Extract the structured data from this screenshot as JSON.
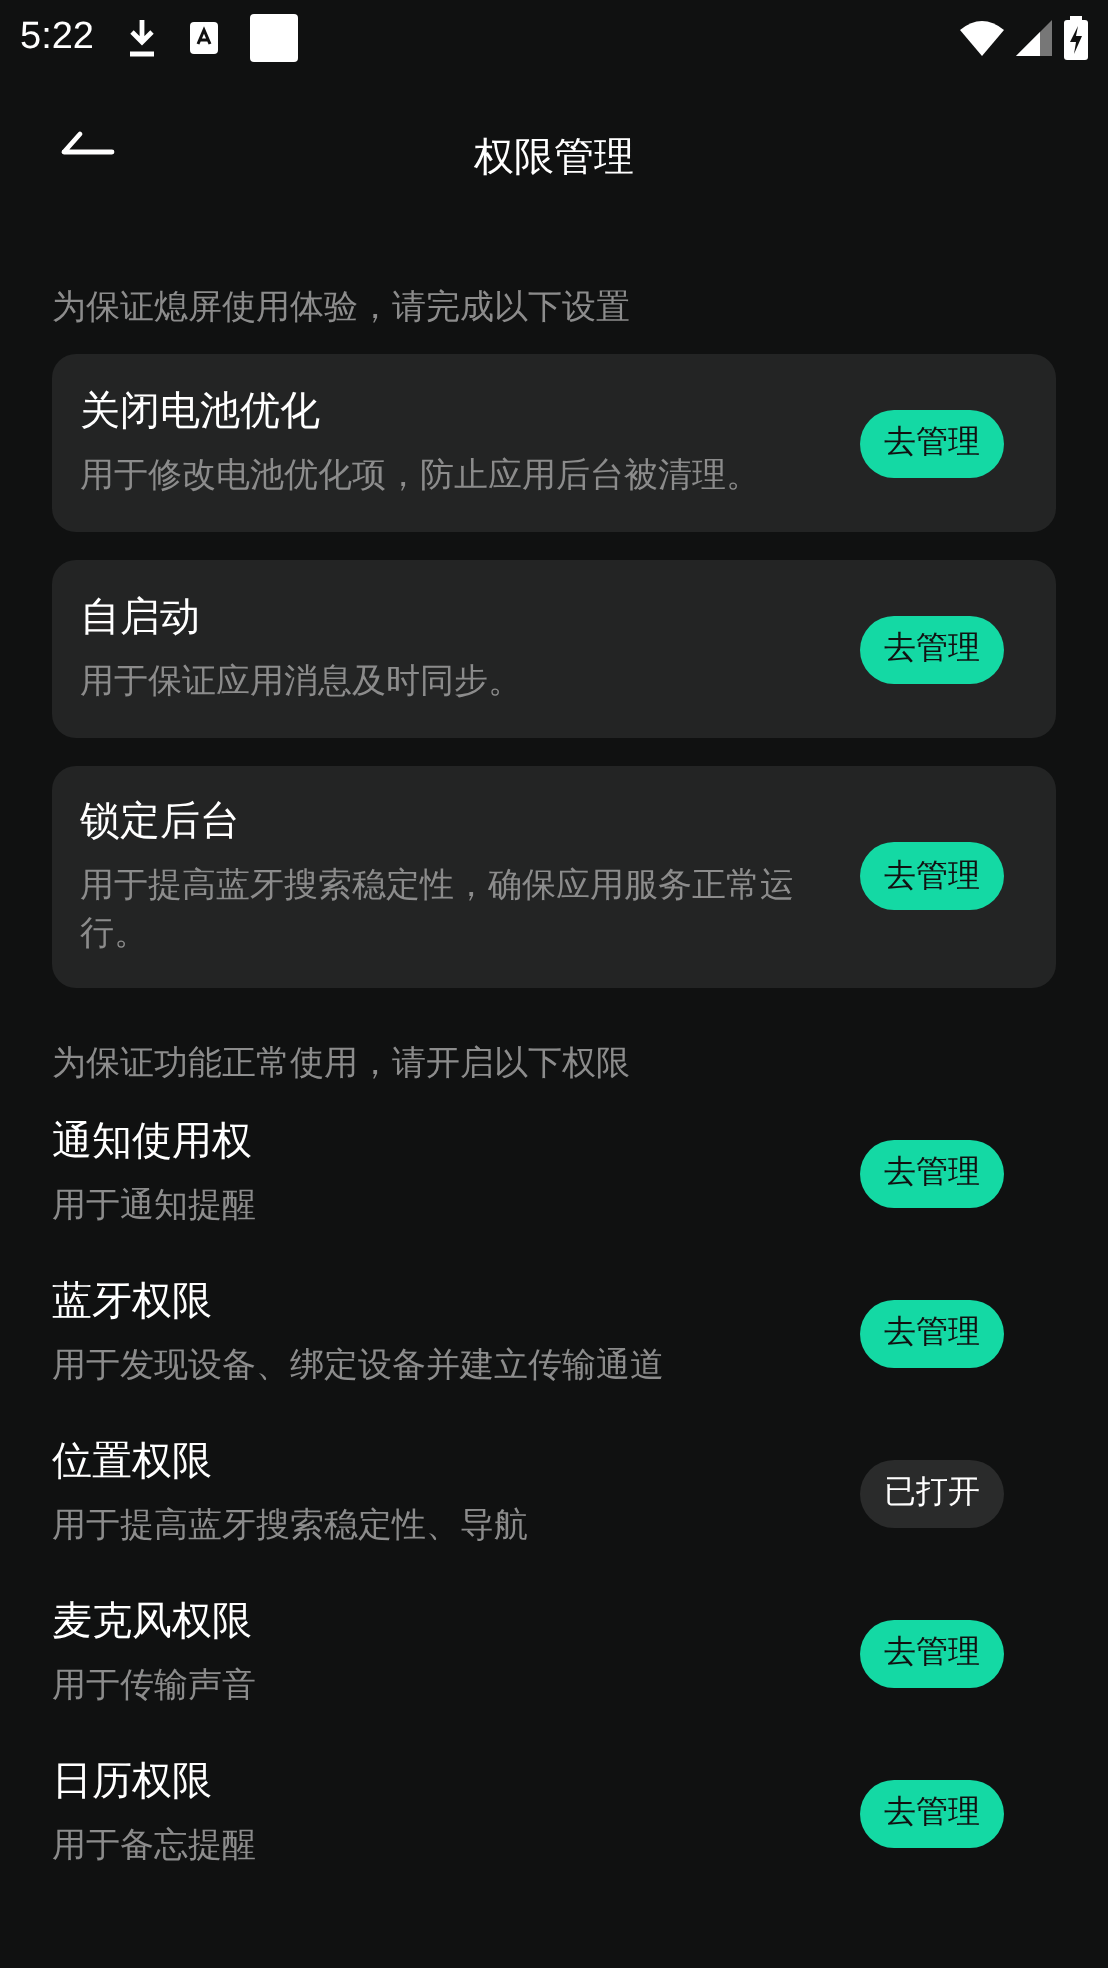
{
  "status_bar": {
    "time": "5:22"
  },
  "header": {
    "title": "权限管理"
  },
  "section_1": {
    "label": "为保证熄屏使用体验，请完成以下设置",
    "cards": [
      {
        "title": "关闭电池优化",
        "description": "用于修改电池优化项，防止应用后台被清理。",
        "button": "去管理",
        "granted": false
      },
      {
        "title": "自启动",
        "description": "用于保证应用消息及时同步。",
        "button": "去管理",
        "granted": false
      },
      {
        "title": "锁定后台",
        "description": "用于提高蓝牙搜索稳定性，确保应用服务正常运行。",
        "button": "去管理",
        "granted": false
      }
    ]
  },
  "section_2": {
    "label": "为保证功能正常使用，请开启以下权限",
    "rows": [
      {
        "title": "通知使用权",
        "description": "用于通知提醒",
        "button": "去管理",
        "granted": false
      },
      {
        "title": "蓝牙权限",
        "description": "用于发现设备、绑定设备并建立传输通道",
        "button": "去管理",
        "granted": false
      },
      {
        "title": "位置权限",
        "description": "用于提高蓝牙搜索稳定性、导航",
        "button": "已打开",
        "granted": true
      },
      {
        "title": "麦克风权限",
        "description": "用于传输声音",
        "button": "去管理",
        "granted": false
      },
      {
        "title": "日历权限",
        "description": "用于备忘提醒",
        "button": "去管理",
        "granted": false
      }
    ]
  }
}
